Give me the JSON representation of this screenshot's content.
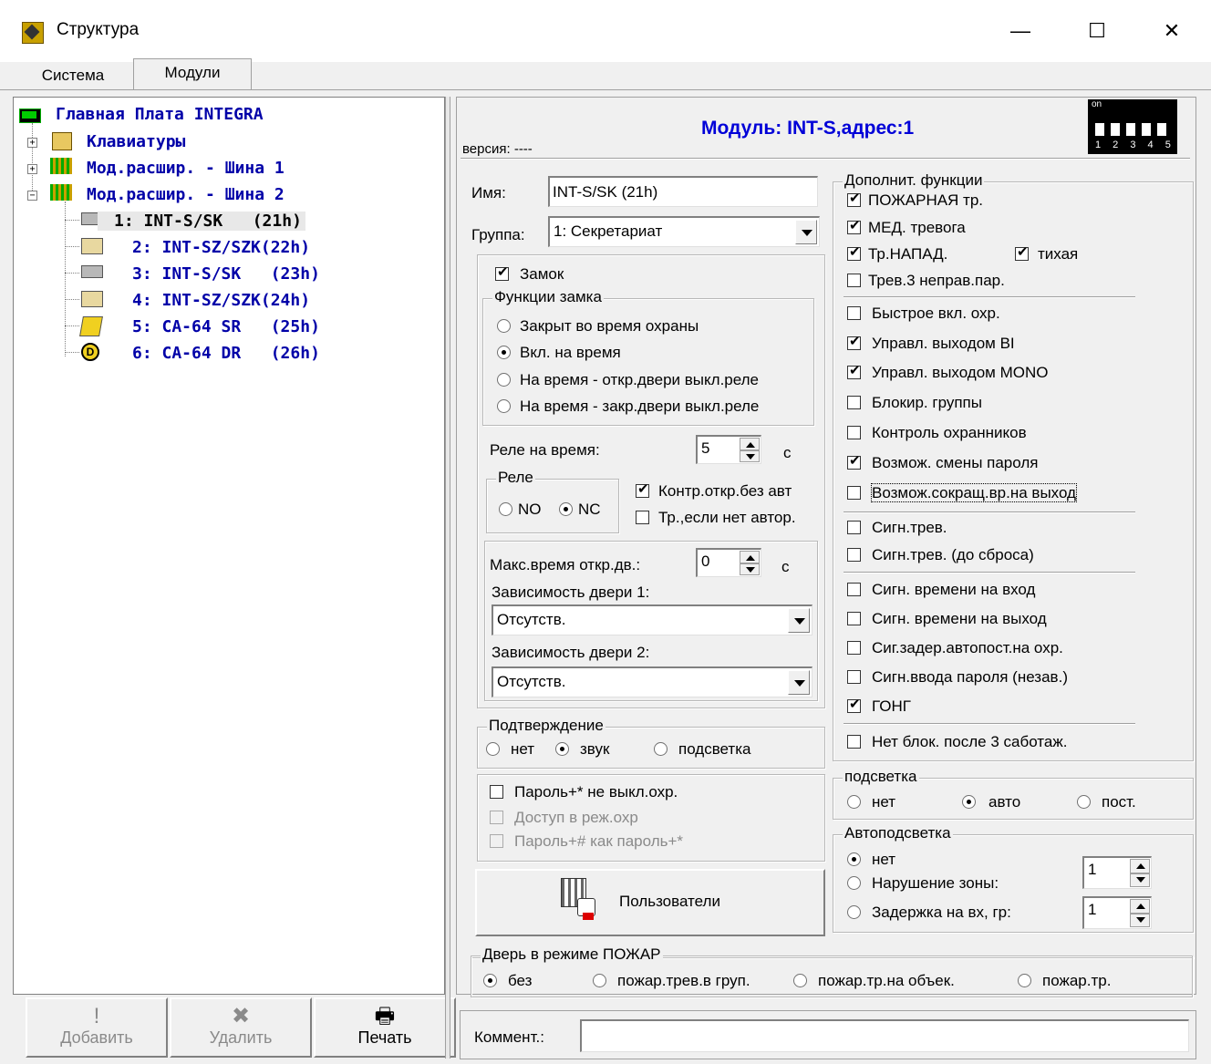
{
  "window": {
    "title": "Структура",
    "min": "—",
    "max": "☐",
    "close": "✕"
  },
  "tabs": [
    {
      "label": "Система"
    },
    {
      "label": "Модули"
    }
  ],
  "tree": {
    "root": "Главная Плата INTEGRA",
    "nodes": [
      {
        "label": "Клавиатуры"
      },
      {
        "label": "Мод.расшир. - Шина 1"
      },
      {
        "label": "Мод.расшир. - Шина 2"
      }
    ],
    "modules": [
      {
        "label": "1: INT-S/SK   (21h)"
      },
      {
        "label": "2: INT-SZ/SZK(22h)"
      },
      {
        "label": "3: INT-S/SK   (23h)"
      },
      {
        "label": "4: INT-SZ/SZK(24h)"
      },
      {
        "label": "5: CA-64 SR   (25h)"
      },
      {
        "label": "6: CA-64 DR   (26h)"
      }
    ]
  },
  "bottom_buttons": {
    "add": "Добавить",
    "delete": "Удалить",
    "print": "Печать"
  },
  "module": {
    "header": "Модуль: INT-S,адрес:1",
    "version_label": "версия: ----",
    "dip_label": "on",
    "dip_numbers": "1 2 3 4 5",
    "name_label": "Имя:",
    "name_value": "INT-S/SK (21h)",
    "group_label": "Группа:",
    "group_value": "1: Секретариат",
    "lock_label": "Замок",
    "lock_functions": {
      "title": "Функции замка",
      "options": [
        "Закрыт во время охраны",
        "Вкл. на время",
        "На время - откр.двери выкл.реле",
        "На время - закр.двери выкл.реле"
      ]
    },
    "relay_time_label": "Реле на время:",
    "relay_time_value": "5",
    "relay_time_unit": "c",
    "relay": {
      "title": "Реле",
      "no": "NO",
      "nc": "NC"
    },
    "ctrl_open": "Контр.откр.без авт",
    "tr_if_no_author": "Тр.,если нет автор.",
    "max_open_label": "Макс.время откр.дв.:",
    "max_open_value": "0",
    "max_open_unit": "c",
    "dep1_label": "Зависимость двери 1:",
    "dep1_value": "Отсутств.",
    "dep2_label": "Зависимость двери 2:",
    "dep2_value": "Отсутств.",
    "confirm": {
      "title": "Подтверждение",
      "none": "нет",
      "sound": "звук",
      "light": "подсветка"
    },
    "pass_options": [
      "Пароль+* не выкл.охр.",
      "Доступ в реж.охр",
      "Пароль+# как пароль+*"
    ],
    "users_button": "Пользователи",
    "extra": {
      "title": "Дополнит. функции",
      "items": [
        "ПОЖАРНАЯ тр.",
        "МЕД. тревога",
        "Тр.НАПАД.",
        "Трев.3 неправ.пар.",
        "Быстрое вкл. охр.",
        "Управл. выходом BI",
        "Управл. выходом MONO",
        "Блокир. группы",
        "Контроль охранников",
        "Возмож. смены пароля",
        "Возмож.сокращ.вр.на выход",
        "Сигн.трев.",
        "Сигн.трев. (до сброса)",
        "Сигн. времени на вход",
        "Сигн. времени на выход",
        "Сиг.задер.автопост.на охр.",
        "Сигн.ввода пароля (незав.)",
        "ГОНГ",
        "Нет блок. после 3 саботаж."
      ],
      "silent": "тихая"
    },
    "backlight": {
      "title": "подсветка",
      "none": "нет",
      "auto": "авто",
      "const": "пост."
    },
    "autolight": {
      "title": "Автоподсветка",
      "none": "нет",
      "zone": "Нарушение зоны:",
      "delay": "Задержка на вх, гр:",
      "zone_value": "1",
      "delay_value": "1"
    },
    "fire_door": {
      "title": "Дверь в режиме ПОЖАР",
      "opts": [
        "без",
        "пожар.трев.в груп.",
        "пожар.тр.на объек.",
        "пожар.тр."
      ]
    },
    "comment_label": "Коммент.:",
    "comment_value": ""
  }
}
